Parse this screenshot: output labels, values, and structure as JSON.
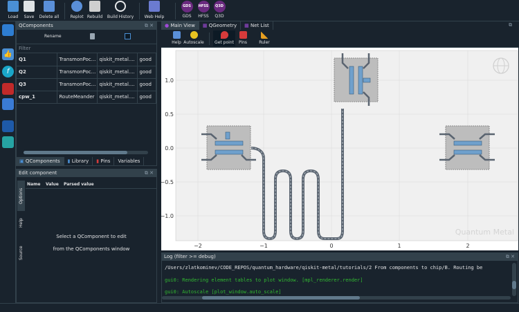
{
  "toolbar": {
    "buttons": [
      {
        "label": "Load",
        "icon": "load-icon",
        "color": "#4a8fd4"
      },
      {
        "label": "Save",
        "icon": "save-icon",
        "color": "#e6e8ea"
      },
      {
        "label": "Delete all",
        "icon": "delete-all-icon",
        "color": "#4a8fd4"
      },
      {
        "label": "Replot",
        "icon": "replot-icon",
        "color": "#4a8fd4"
      },
      {
        "label": "Rebuild",
        "icon": "rebuild-icon",
        "color": "#d8d8d8"
      },
      {
        "label": "Build History",
        "icon": "build-history-icon",
        "color": "#e6e8ea"
      },
      {
        "label": "Web Help",
        "icon": "web-help-icon",
        "color": "#6b7bd0"
      },
      {
        "label": "GDS",
        "icon": "GDS"
      },
      {
        "label": "HFSS",
        "icon": "HFSS"
      },
      {
        "label": "Q3D",
        "icon": "Q3D"
      }
    ]
  },
  "qcomponents": {
    "title": "QComponents",
    "rename_label": "Rename",
    "filter_placeholder": "Filter",
    "rows": [
      [
        "Q1",
        "TransmonPoc...",
        "qiskit_metal....",
        "good"
      ],
      [
        "Q2",
        "TransmonPoc...",
        "qiskit_metal....",
        "good"
      ],
      [
        "Q3",
        "TransmonPoc...",
        "qiskit_metal....",
        "good"
      ],
      [
        "cpw_1",
        "RouteMeander",
        "qiskit_metal....",
        "good"
      ]
    ],
    "tabs": [
      "QComponents",
      "Library",
      "Pins",
      "Variables"
    ]
  },
  "edit_component": {
    "title": "Edit component",
    "columns": [
      "Name",
      "Value",
      "Parsed value"
    ],
    "message_line1": "Select a QComponent to edit",
    "message_line2": "from the QComponents window",
    "side_tabs": [
      "Options",
      "Help",
      "Source"
    ]
  },
  "main_tabs": [
    "Main View",
    "QGeometry",
    "Net List"
  ],
  "plot_toolbar": [
    "Help",
    "Autoscale",
    "Get point",
    "Pins",
    "Ruler"
  ],
  "plot": {
    "x_ticks": [
      "−2",
      "−1",
      "0",
      "1",
      "2"
    ],
    "y_ticks": [
      "1.0",
      "0.5",
      "0.0",
      "−0.5",
      "−1.0"
    ],
    "watermark": "Quantum Metal"
  },
  "log": {
    "title": "Log  (filter >= debug)",
    "lines": [
      {
        "text": "/Users/zlatkominev/CODE_REPOS/quantum_hardware/qiskit-metal/tutorials/2 From components to chip/B. Routing be",
        "color": "#e0e1e3"
      },
      {
        "text": "gui0: Rendering element tables to plot window. [mpl_renderer.render]",
        "color": "#31b831"
      },
      {
        "text": "gui0: Autoscale [plot_window.auto_scale]",
        "color": "#31b831"
      }
    ]
  }
}
